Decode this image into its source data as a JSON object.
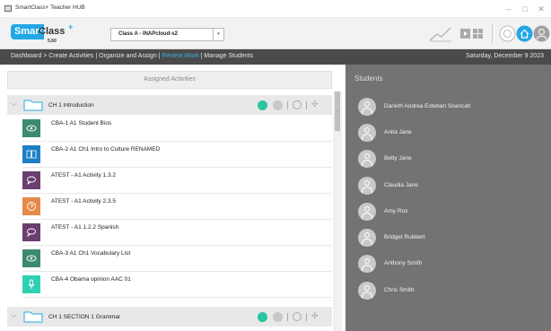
{
  "window": {
    "title": "SmartClass+ Teacher HUB",
    "controls": [
      "–",
      "□",
      "✕"
    ]
  },
  "toolbar": {
    "logo_smart": "Smart",
    "logo_class": "Class",
    "logo_plus": "+",
    "logo_version": "5.60",
    "class_selected": "Class A - INAPcloud-s2",
    "select_arrow": "▾",
    "icons": [
      "chart-icon",
      "presentation-icon",
      "record-icon",
      "home-icon",
      "user-icon"
    ]
  },
  "nav": {
    "breadcrumb_prefix": "Dashboard > Create Activities | Organize and Assign | ",
    "breadcrumb_active": "Review Work",
    "breadcrumb_suffix": " | Manage Students",
    "date": "Saturday, December 9 2023"
  },
  "assigned": {
    "header": "Assigned Activities",
    "sections": [
      {
        "title": "CH 1 Introduction",
        "activities": [
          {
            "label": "CBA-1 A1 Student Bios",
            "icon": "eye-icon",
            "color": "#3d8a6e"
          },
          {
            "label": "CBA-2 A1 Ch1 Intro to Culture RENAMED",
            "icon": "book-icon",
            "color": "#1f7fc4"
          },
          {
            "label": "ATEST - A1 Activity 1.3.2",
            "icon": "speech-bubble-icon",
            "color": "#6a3f6e"
          },
          {
            "label": "ATEST - A1 Activity 2.3.5",
            "icon": "question-icon",
            "color": "#e58a4a"
          },
          {
            "label": "ATEST - A1 1.2.2 Spanish",
            "icon": "speech-bubble-icon",
            "color": "#6a3f6e"
          },
          {
            "label": "CBA-3 A1 Ch1 Vocabulary List",
            "icon": "eye-icon",
            "color": "#3d8a6e"
          },
          {
            "label": "CBA-4 Obama opinion AAC 01",
            "icon": "microphone-icon",
            "color": "#2fd1b2"
          }
        ]
      },
      {
        "title": "CH 1 SECTION 1 Grammar",
        "activities": []
      }
    ],
    "move_glyph": "✣"
  },
  "students": {
    "title": "Students",
    "list": [
      "Darieth Andrea Esteban Soancatl",
      "Anita Jane",
      "Betty Jane",
      "Claudia Jane",
      "Amy Rox",
      "Bridget Rubbert",
      "Anthony Smith",
      "Chris Smith"
    ]
  },
  "colors": {
    "accent": "#22a7e6",
    "nav_bg": "#4a4a4a",
    "students_bg": "#737373",
    "toggle_on": "#2ac4a0"
  }
}
